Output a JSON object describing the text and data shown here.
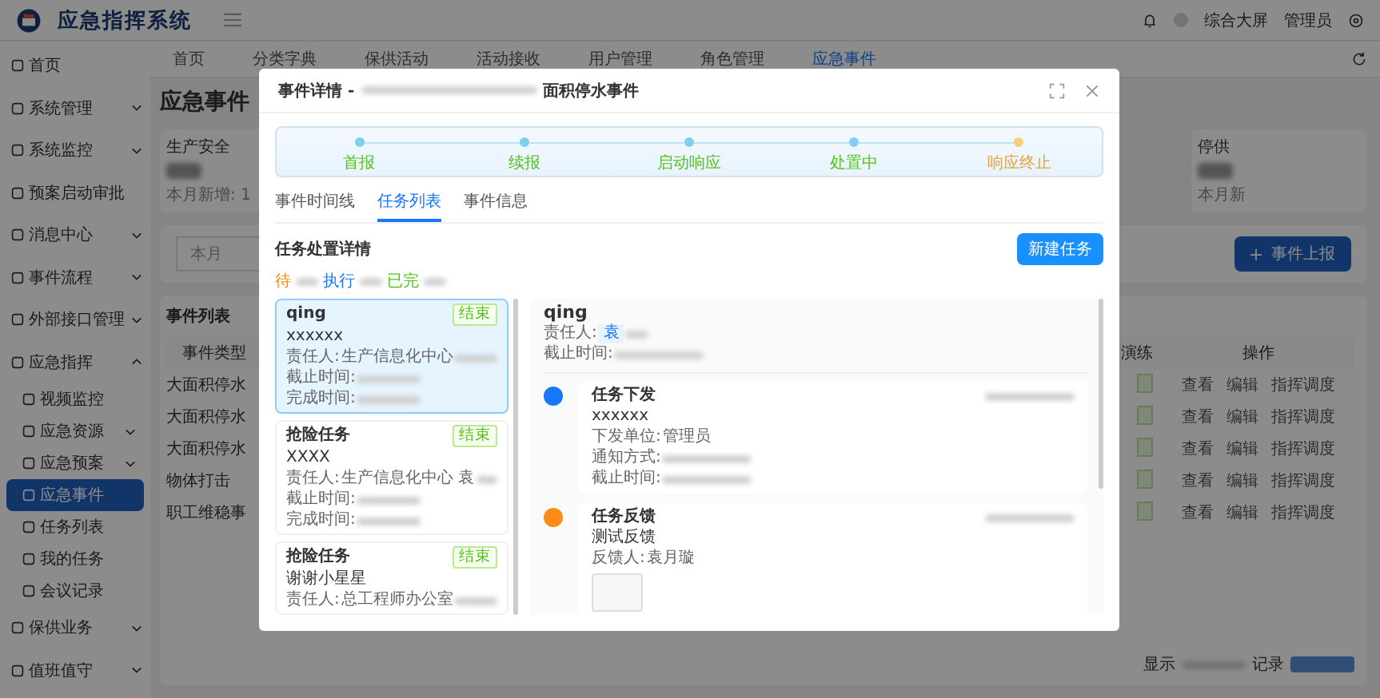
{
  "header": {
    "title": "应急指挥系统",
    "links": [
      "综合大屏",
      "管理员"
    ]
  },
  "sidebar": {
    "items": [
      {
        "label": "首页",
        "selected": false
      },
      {
        "label": "系统管理",
        "selected": false,
        "expanded": false
      },
      {
        "label": "系统监控",
        "selected": false,
        "expanded": false
      },
      {
        "label": "预案启动审批",
        "selected": false
      },
      {
        "label": "消息中心",
        "selected": false,
        "expanded": false
      },
      {
        "label": "事件流程",
        "selected": false,
        "expanded": false
      },
      {
        "label": "外部接口管理",
        "selected": false,
        "expanded": false
      },
      {
        "label": "应急指挥",
        "selected": false,
        "expanded": true,
        "children": [
          {
            "label": "视频监控",
            "selected": false
          },
          {
            "label": "应急资源",
            "selected": false,
            "expanded": false
          },
          {
            "label": "应急预案",
            "selected": false,
            "expanded": false
          },
          {
            "label": "应急事件",
            "selected": true
          },
          {
            "label": "任务列表",
            "selected": false
          },
          {
            "label": "我的任务",
            "selected": false
          },
          {
            "label": "会议记录",
            "selected": false
          }
        ]
      },
      {
        "label": "保供业务",
        "selected": false,
        "expanded": false
      },
      {
        "label": "值班值守",
        "selected": false,
        "expanded": false
      }
    ]
  },
  "tabs": [
    {
      "label": "首页",
      "selected": false
    },
    {
      "label": "分类字典",
      "selected": false
    },
    {
      "label": "保供活动",
      "selected": false
    },
    {
      "label": "活动接收",
      "selected": false
    },
    {
      "label": "用户管理",
      "selected": false
    },
    {
      "label": "角色管理",
      "selected": false
    },
    {
      "label": "应急事件",
      "selected": true
    }
  ],
  "page_title": "应急事件",
  "stats": [
    {
      "label": "生产安全",
      "note": "本月新增: 1"
    },
    {
      "label": "停供",
      "note": "本月新"
    }
  ],
  "filter": {
    "period": "本月",
    "report_button": "事件上报"
  },
  "table": {
    "title": "事件列表",
    "columns": [
      "事件类型",
      "演练",
      "操作"
    ],
    "rows": [
      {
        "type": "大面积停水",
        "actions": [
          "查看",
          "编辑",
          "指挥调度"
        ]
      },
      {
        "type": "大面积停水",
        "actions": [
          "查看",
          "编辑",
          "指挥调度"
        ]
      },
      {
        "type": "大面积停水",
        "actions": [
          "查看",
          "编辑",
          "指挥调度"
        ]
      },
      {
        "type": "物体打击",
        "actions": [
          "查看",
          "编辑",
          "指挥调度"
        ]
      },
      {
        "type": "职工维稳事",
        "actions": [
          "查看",
          "编辑",
          "指挥调度"
        ]
      }
    ]
  },
  "pagination": {
    "show": "显示",
    "records": "记录"
  },
  "modal": {
    "title": "事件详情 - ",
    "title_end": "面积停水事件",
    "steps": [
      {
        "label": "首报",
        "color": "#52c41a"
      },
      {
        "label": "续报",
        "color": "#52c41a"
      },
      {
        "label": "启动响应",
        "color": "#52c41a"
      },
      {
        "label": "处置中",
        "color": "#52c41a"
      },
      {
        "label": "响应终止",
        "color": "#e6a23c"
      }
    ],
    "tabs": [
      {
        "label": "事件时间线",
        "selected": false
      },
      {
        "label": "任务列表",
        "selected": true
      },
      {
        "label": "事件信息",
        "selected": false
      }
    ],
    "section_title": "任务处置详情",
    "new_button": "新建任务",
    "legend": [
      {
        "label": "待",
        "color": "#fa8c16"
      },
      {
        "label": "执行",
        "color": "#1677ff"
      },
      {
        "label": "已完",
        "color": "#52c41a"
      }
    ],
    "tasks": [
      {
        "title": "qing",
        "tag": "结束",
        "desc": "xxxxxx",
        "selected": true,
        "lines": [
          {
            "label": "责任人: ",
            "value": "生产信息化中心"
          },
          {
            "label": "截止时间: "
          },
          {
            "label": "完成时间: "
          }
        ]
      },
      {
        "title": "抢险任务",
        "tag": "结束",
        "desc": "XXXX",
        "selected": false,
        "lines": [
          {
            "label": "责任人: ",
            "value": "生产信息化中心 袁"
          },
          {
            "label": "截止时间: "
          },
          {
            "label": "完成时间: "
          }
        ]
      },
      {
        "title": "抢险任务",
        "tag": "结束",
        "desc": "谢谢小星星",
        "selected": false,
        "lines": [
          {
            "label": "责任人: ",
            "value": "总工程师办公室"
          }
        ]
      }
    ],
    "detail": {
      "title": "qing",
      "owner_label": "责任人: ",
      "owner_tag": "袁",
      "deadline_label": "截止时间: ",
      "timeline": [
        {
          "title": "任务下发",
          "color": "#1677ff",
          "desc": "xxxxxx",
          "lines": [
            {
              "label": "下发单位: ",
              "value": "管理员"
            },
            {
              "label": "通知方式: "
            },
            {
              "label": "截止时间: "
            }
          ],
          "image": false
        },
        {
          "title": "任务反馈",
          "color": "#fa8c16",
          "desc": "测试反馈",
          "lines": [
            {
              "label": "反馈人: ",
              "value": "袁月璇"
            }
          ],
          "image": true
        }
      ]
    }
  }
}
